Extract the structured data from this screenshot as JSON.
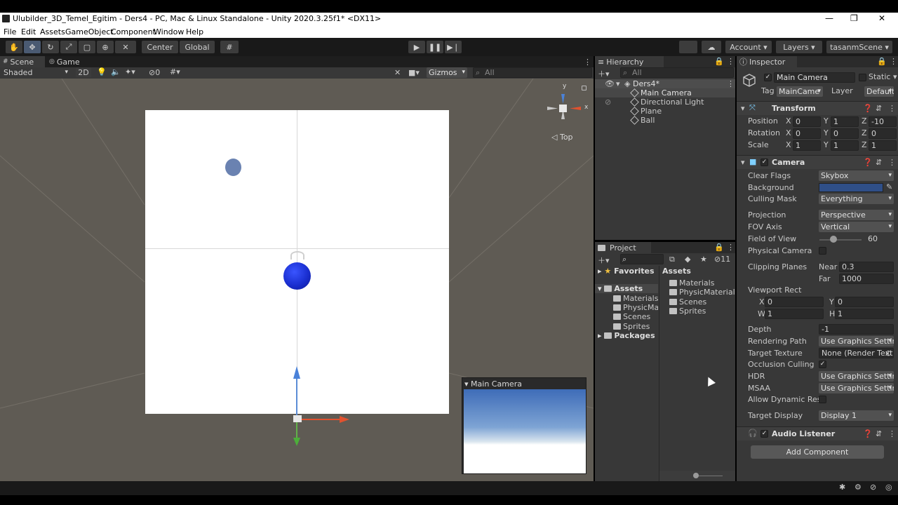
{
  "window": {
    "title": "Ulubilder_3D_Temel_Egitim - Ders4 - PC, Mac & Linux Standalone - Unity 2020.3.25f1* <DX11>",
    "minimize": "—",
    "maximize": "❐",
    "close": "✕"
  },
  "menu": [
    "File",
    "Edit",
    "Assets",
    "GameObject",
    "Component",
    "Window",
    "Help"
  ],
  "toolbar": {
    "pivot": "Center",
    "space": "Global",
    "account": "Account",
    "layers": "Layers",
    "layout": "tasanmScene"
  },
  "scene": {
    "tabs": [
      "Scene",
      "Game"
    ],
    "shading": "Shaded",
    "mode_2d": "2D",
    "hidden_count": "0",
    "gizmos": "Gizmos",
    "search_placeholder": "All",
    "gizmo_view": "Top",
    "gizmo_axis_y": "y",
    "gizmo_axis_x": "x",
    "camera_preview_title": "Main Camera"
  },
  "hierarchy": {
    "title": "Hierarchy",
    "search_placeholder": "All",
    "scene_name": "Ders4*",
    "items": [
      "Main Camera",
      "Directional Light",
      "Plane",
      "Ball"
    ]
  },
  "project": {
    "title": "Project",
    "hidden_count": "11",
    "tree": {
      "favorites": "Favorites",
      "assets": "Assets",
      "asset_children": [
        "Materials",
        "PhysicMat",
        "Scenes",
        "Sprites"
      ],
      "packages": "Packages"
    },
    "breadcrumb": "Assets",
    "folders": [
      "Materials",
      "PhysicMaterial",
      "Scenes",
      "Sprites"
    ]
  },
  "inspector": {
    "title": "Inspector",
    "object_name": "Main Camera",
    "static_label": "Static",
    "tag_label": "Tag",
    "tag_value": "MainCame",
    "layer_label": "Layer",
    "layer_value": "Default",
    "transform": {
      "title": "Transform",
      "position_label": "Position",
      "rotation_label": "Rotation",
      "scale_label": "Scale",
      "axis_x": "X",
      "axis_y": "Y",
      "axis_z": "Z",
      "position": [
        "0",
        "1",
        "-10"
      ],
      "rotation": [
        "0",
        "0",
        "0"
      ],
      "scale": [
        "1",
        "1",
        "1"
      ]
    },
    "camera": {
      "title": "Camera",
      "clear_flags_label": "Clear Flags",
      "clear_flags": "Skybox",
      "background_label": "Background",
      "background_color": "#2f4f88",
      "culling_mask_label": "Culling Mask",
      "culling_mask": "Everything",
      "projection_label": "Projection",
      "projection": "Perspective",
      "fov_axis_label": "FOV Axis",
      "fov_axis": "Vertical",
      "fov_label": "Field of View",
      "fov_value": "60",
      "fov_fraction": 0.33,
      "physical_camera_label": "Physical Camera",
      "clipping_label": "Clipping Planes",
      "near_label": "Near",
      "near": "0.3",
      "far_label": "Far",
      "far": "1000",
      "viewport_label": "Viewport Rect",
      "vp_x_label": "X",
      "vp_x": "0",
      "vp_y_label": "Y",
      "vp_y": "0",
      "vp_w_label": "W",
      "vp_w": "1",
      "vp_h_label": "H",
      "vp_h": "1",
      "depth_label": "Depth",
      "depth": "-1",
      "rendering_path_label": "Rendering Path",
      "rendering_path": "Use Graphics Settir",
      "target_texture_label": "Target Texture",
      "target_texture": "None (Render Text",
      "occlusion_label": "Occlusion Culling",
      "hdr_label": "HDR",
      "hdr": "Use Graphics Settir",
      "msaa_label": "MSAA",
      "msaa": "Use Graphics Settir",
      "dynamic_res_label": "Allow Dynamic Reso",
      "target_display_label": "Target Display",
      "target_display": "Display 1"
    },
    "audio_listener": {
      "title": "Audio Listener"
    },
    "add_component": "Add Component"
  },
  "colors": {
    "accent": "#4a5a72",
    "ball": "#1a2fd0",
    "panel": "#383838"
  }
}
